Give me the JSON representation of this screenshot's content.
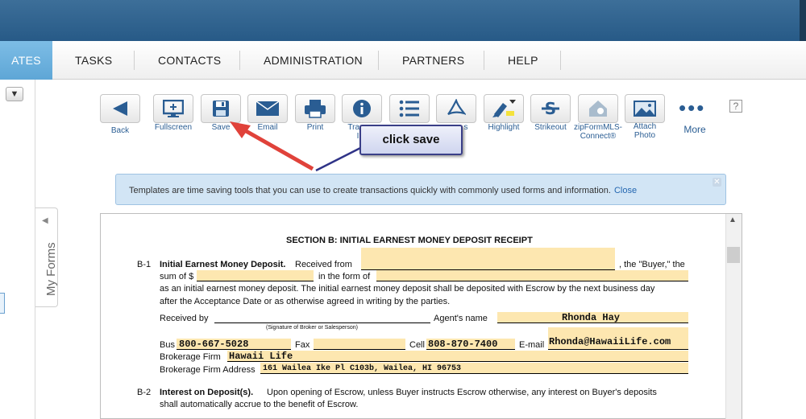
{
  "nav": {
    "items": [
      "ATES",
      "TASKS",
      "CONTACTS",
      "ADMINISTRATION",
      "PARTNERS",
      "HELP"
    ]
  },
  "left": {
    "dropdown_icon": "chevron-down-icon",
    "myforms_label": "My Forms"
  },
  "toolbar": {
    "back": "Back",
    "fullscreen": "Fullscreen",
    "save": "Save",
    "email": "Email",
    "print": "Print",
    "transaction": "Trans",
    "transaction2": "I",
    "checklist": "",
    "pdf": "s",
    "highlight": "Highlight",
    "strikeout": "Strikeout",
    "zipform1": "zipFormMLS-",
    "zipform2": "Connect®",
    "attach1": "Attach",
    "attach2": "Photo",
    "more": "More",
    "help": "?"
  },
  "callout": {
    "text": "click save"
  },
  "info_bar": {
    "text": "Templates are time saving tools that you can use to create transactions quickly with commonly used forms and information.",
    "close": "Close"
  },
  "form": {
    "section_title": "SECTION B: INITIAL EARNEST MONEY DEPOSIT RECEIPT",
    "b1": {
      "num": "B-1",
      "heading": "Initial Earnest Money Deposit.",
      "received_from": "Received from",
      "buyer": ", the \"Buyer,\" the",
      "sum_of": "sum of $",
      "in_form_of": "in the form of",
      "line3": "as an initial earnest money deposit. The initial earnest money deposit shall be deposited with Escrow by the next business day",
      "line4": "after the Acceptance Date or as otherwise agreed in writing by the parties.",
      "received_by": "Received by",
      "signature_note": "(Signature of Broker or Salesperson)",
      "agents_name_label": "Agent's name",
      "agents_name": "Rhonda Hay",
      "bus_label": "Bus",
      "bus": "800-667-5028",
      "fax_label": "Fax",
      "fax": "",
      "cell_label": "Cell",
      "cell": "808-870-7400",
      "email_label": "E-mail",
      "email": "Rhonda@HawaiiLife.com",
      "firm_label": "Brokerage Firm",
      "firm": "Hawaii Life",
      "firm_address_label": "Brokerage Firm Address",
      "firm_address": "161 Wailea Ike Pl C103b, Wailea, HI  96753"
    },
    "b2": {
      "num": "B-2",
      "heading": "Interest on Deposit(s).",
      "text1": "Upon opening of Escrow, unless Buyer instructs Escrow otherwise, any interest on Buyer's deposits",
      "text2": "shall automatically accrue to the benefit of Escrow."
    }
  },
  "colors": {
    "topbar": "#2f6390",
    "active_tab": "#6cb0de",
    "field": "#fde7b0",
    "link": "#2a5d93",
    "arrow": "#e0423a"
  }
}
